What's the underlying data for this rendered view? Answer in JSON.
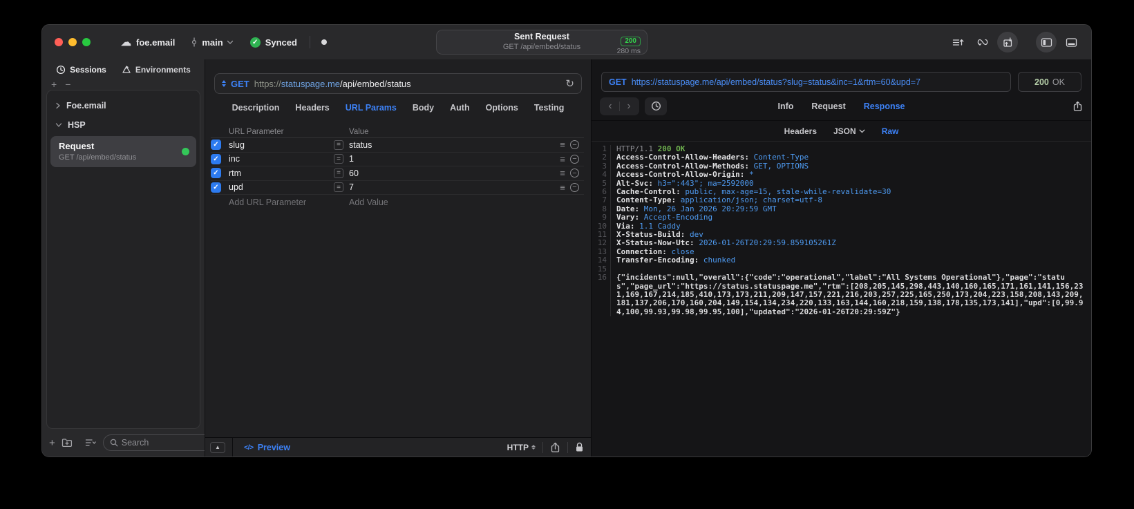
{
  "icons": {
    "cloud": "☁",
    "check": "✓",
    "reorder": "≡",
    "minus": "−",
    "plus": "+",
    "equals": "=",
    "collapse_up": "▲",
    "refresh": "↻",
    "back": "‹",
    "forward": "›",
    "preview_code": "</>"
  },
  "titlebar": {
    "project": "foe.email",
    "branch": "main",
    "sync_status": "Synced",
    "request_title": "Sent Request",
    "request_subtitle": "GET /api/embed/status",
    "status_code": "200",
    "duration": "280 ms"
  },
  "sidebar": {
    "tab_sessions": "Sessions",
    "tab_environments": "Environments",
    "group1": "Foe.email",
    "group2": "HSP",
    "request_name": "Request",
    "request_detail": "GET /api/embed/status",
    "search_placeholder": "Search"
  },
  "request_panel": {
    "method": "GET",
    "url_scheme": "https://",
    "url_host": "statuspage.me",
    "url_path": "/api/embed/status",
    "tabs": [
      "Description",
      "Headers",
      "URL Params",
      "Body",
      "Auth",
      "Options",
      "Testing"
    ],
    "active_tab": "URL Params",
    "table": {
      "col_param": "URL Parameter",
      "col_value": "Value",
      "rows": [
        {
          "name": "slug",
          "value": "status",
          "enabled": true
        },
        {
          "name": "inc",
          "value": "1",
          "enabled": true
        },
        {
          "name": "rtm",
          "value": "60",
          "enabled": true
        },
        {
          "name": "upd",
          "value": "7",
          "enabled": true
        }
      ],
      "add_param": "Add URL Parameter",
      "add_value": "Add Value"
    },
    "footer": {
      "preview": "Preview",
      "protocol": "HTTP"
    }
  },
  "response_panel": {
    "method": "GET",
    "url": "https://statuspage.me/api/embed/status?slug=status&inc=1&rtm=60&upd=7",
    "status_code": "200",
    "status_text": "OK",
    "tab_info": "Info",
    "tab_request": "Request",
    "tab_response": "Response",
    "active_tab": "Response",
    "subtab_headers": "Headers",
    "subtab_json": "JSON",
    "subtab_raw": "Raw",
    "active_subtab": "Raw",
    "raw_lines": [
      {
        "n": "1",
        "prefix": "HTTP/1.1",
        "status": "200 OK"
      },
      {
        "n": "2",
        "name": "Access-Control-Allow-Headers:",
        "value": "Content-Type"
      },
      {
        "n": "3",
        "name": "Access-Control-Allow-Methods:",
        "value": "GET, OPTIONS"
      },
      {
        "n": "4",
        "name": "Access-Control-Allow-Origin:",
        "value": "*"
      },
      {
        "n": "5",
        "name": "Alt-Svc:",
        "value": "h3=\":443\"; ma=2592000"
      },
      {
        "n": "6",
        "name": "Cache-Control:",
        "value": "public, max-age=15, stale-while-revalidate=30"
      },
      {
        "n": "7",
        "name": "Content-Type:",
        "value": "application/json; charset=utf-8"
      },
      {
        "n": "8",
        "name": "Date:",
        "value": "Mon, 26 Jan 2026 20:29:59 GMT"
      },
      {
        "n": "9",
        "name": "Vary:",
        "value": "Accept-Encoding"
      },
      {
        "n": "10",
        "name": "Via:",
        "value": "1.1 Caddy"
      },
      {
        "n": "11",
        "name": "X-Status-Build:",
        "value": "dev"
      },
      {
        "n": "12",
        "name": "X-Status-Now-Utc:",
        "value": "2026-01-26T20:29:59.859105261Z"
      },
      {
        "n": "13",
        "name": "Connection:",
        "value": "close"
      },
      {
        "n": "14",
        "name": "Transfer-Encoding:",
        "value": "chunked"
      },
      {
        "n": "15"
      },
      {
        "n": "16"
      }
    ],
    "body": "{\"incidents\":null,\"overall\":{\"code\":\"operational\",\"label\":\"All Systems Operational\"},\"page\":\"status\",\"page_url\":\"https://status.statuspage.me\",\"rtm\":[208,205,145,298,443,140,160,165,171,161,141,156,231,169,167,214,185,410,173,173,211,209,147,157,221,216,203,257,225,165,250,173,204,223,158,208,143,209,181,137,206,170,160,204,149,154,134,234,220,133,163,144,160,218,159,138,178,135,173,141],\"upd\":[0,99.94,100,99.93,99.98,99.95,100],\"updated\":\"2026-01-26T20:29:59Z\"}"
  }
}
